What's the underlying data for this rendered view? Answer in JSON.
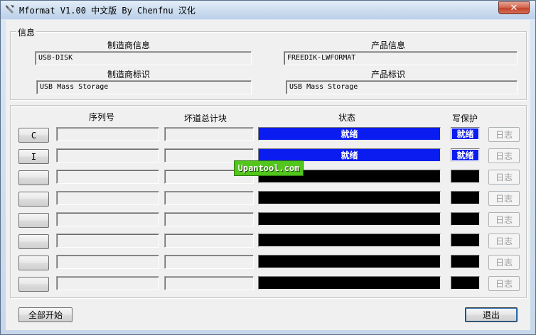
{
  "window": {
    "title": "Mformat V1.00 中文版 By Chenfnu 汉化",
    "close_glyph": "✕"
  },
  "info": {
    "group_label": "信息",
    "manufacturer_info_label": "制造商信息",
    "manufacturer_info_value": "USB-DISK",
    "product_info_label": "产品信息",
    "product_info_value": "FREEDIK-LWFORMAT",
    "manufacturer_id_label": "制造商标识",
    "manufacturer_id_value": "USB Mass Storage",
    "product_id_label": "产品标识",
    "product_id_value": "USB Mass Storage"
  },
  "ports": {
    "headers": {
      "serial": "序列号",
      "bad_blocks": "坏道总计块",
      "status": "状态",
      "write_protect": "写保护"
    },
    "rows": [
      {
        "drive": "C",
        "serial": "",
        "bad_blocks": "",
        "status": "就绪",
        "write_protect": "就绪",
        "log": "日志",
        "active": true
      },
      {
        "drive": "I",
        "serial": "",
        "bad_blocks": "",
        "status": "就绪",
        "write_protect": "就绪",
        "log": "日志",
        "active": true
      },
      {
        "drive": "",
        "serial": "",
        "bad_blocks": "",
        "status": "",
        "write_protect": "",
        "log": "日志",
        "active": false
      },
      {
        "drive": "",
        "serial": "",
        "bad_blocks": "",
        "status": "",
        "write_protect": "",
        "log": "日志",
        "active": false
      },
      {
        "drive": "",
        "serial": "",
        "bad_blocks": "",
        "status": "",
        "write_protect": "",
        "log": "日志",
        "active": false
      },
      {
        "drive": "",
        "serial": "",
        "bad_blocks": "",
        "status": "",
        "write_protect": "",
        "log": "日志",
        "active": false
      },
      {
        "drive": "",
        "serial": "",
        "bad_blocks": "",
        "status": "",
        "write_protect": "",
        "log": "日志",
        "active": false
      },
      {
        "drive": "",
        "serial": "",
        "bad_blocks": "",
        "status": "",
        "write_protect": "",
        "log": "日志",
        "active": false
      }
    ]
  },
  "footer": {
    "start_all_label": "全部开始",
    "exit_label": "退出"
  },
  "watermark": {
    "text": "Upantool.com"
  },
  "colors": {
    "status_ready": "#0a1cf0",
    "status_idle": "#000000",
    "watermark_bg": "#52c61c"
  }
}
